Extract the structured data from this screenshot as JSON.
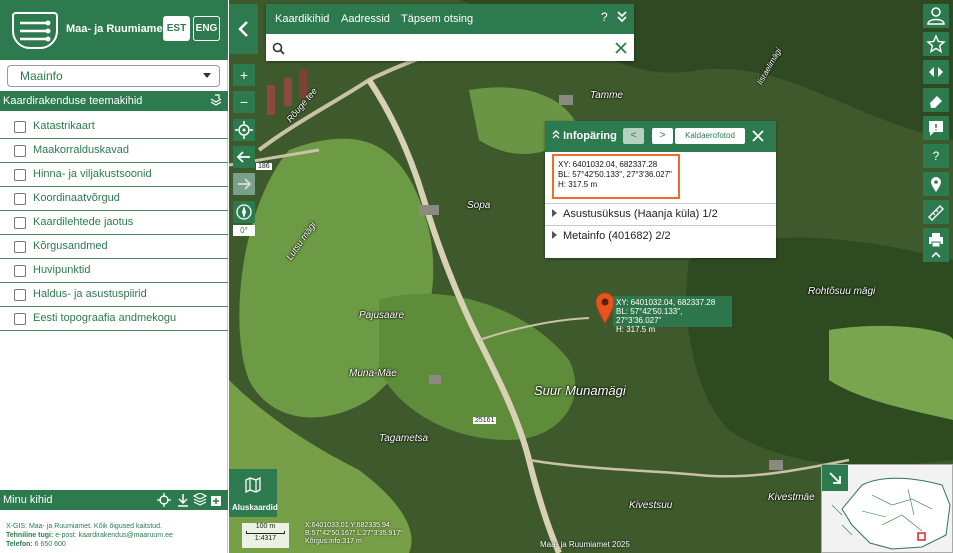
{
  "header": {
    "org_name": "Maa- ja Ruumiamet",
    "lang_est": "EST",
    "lang_eng": "ENG"
  },
  "app_select": {
    "value": "Maainfo"
  },
  "themes": {
    "title": "Kaardirakenduse teemakihid",
    "items": [
      "Katastrikaart",
      "Maakorralduskavad",
      "Hinna- ja viljakustsoonid",
      "Koordinaatvõrgud",
      "Kaardilehtede jaotus",
      "Kõrgusandmed",
      "Huvipunktid",
      "Haldus- ja asustuspiirid",
      "Eesti topograafia andmekogu"
    ]
  },
  "my_layers": {
    "title": "Minu kihid"
  },
  "footer": {
    "line1": "X-GIS: Maa- ja Ruumiamet. Kõik õigused kaitstud.",
    "line2_label": "Tehniline tugi:",
    "line2_value": " e-post: kaardirakendus@maaruum.ee",
    "line3_label": "Telefon:",
    "line3_value": " 6 650 600"
  },
  "search": {
    "tabs": [
      "Kaardikihid",
      "Aadressid",
      "Täpsem otsing"
    ],
    "help": "?",
    "value": "",
    "placeholder": ""
  },
  "tools": {
    "zoom_in": "+",
    "zoom_out": "−",
    "rotation": "0°"
  },
  "info": {
    "title": "Infopäring",
    "prev": "<",
    "next": ">",
    "aerial": "Kaldaerofotod",
    "xy": "XY: 6401032.04, 682337.28",
    "bl": "BL: 57°42'50.133\", 27°3'36.027\"",
    "h": "H: 317.5 m",
    "rows": [
      "Asustusüksus (Haanja küla) 1/2",
      "Metainfo (401682) 2/2"
    ]
  },
  "marker": {
    "xy": "XY: 6401032.04, 682337.28",
    "bl": "BL: 57°42'50.133\", 27°3'36.027\"",
    "h": "H: 317.5 m"
  },
  "places": [
    "Tamme",
    "Sopa",
    "Pajusaare",
    "Muna-Mäe",
    "Tagametsa",
    "Suur Munamägi",
    "Rohtõsuu mägi",
    "Kivestsuu",
    "Kivestmäe",
    "Lutsu mägi",
    "Rõuge tee",
    "Iisraelimägi"
  ],
  "road_labels": [
    "186",
    "25161"
  ],
  "basemaps": {
    "label": "Aluskaardid"
  },
  "scale": {
    "distance": "100 m",
    "ratio": "1:4317"
  },
  "readout": {
    "xy": "X:6401033.01 Y:682335.94",
    "bl": "B:57°42'50.167\" L:27°3'35.917\"",
    "h": "Kõrgus:info:317 m"
  },
  "copyright": "Maa- ja Ruumiamet 2025",
  "colors": {
    "primary": "#2d7a4f",
    "highlight": "#f26a2a",
    "marker": "#e8531e"
  }
}
